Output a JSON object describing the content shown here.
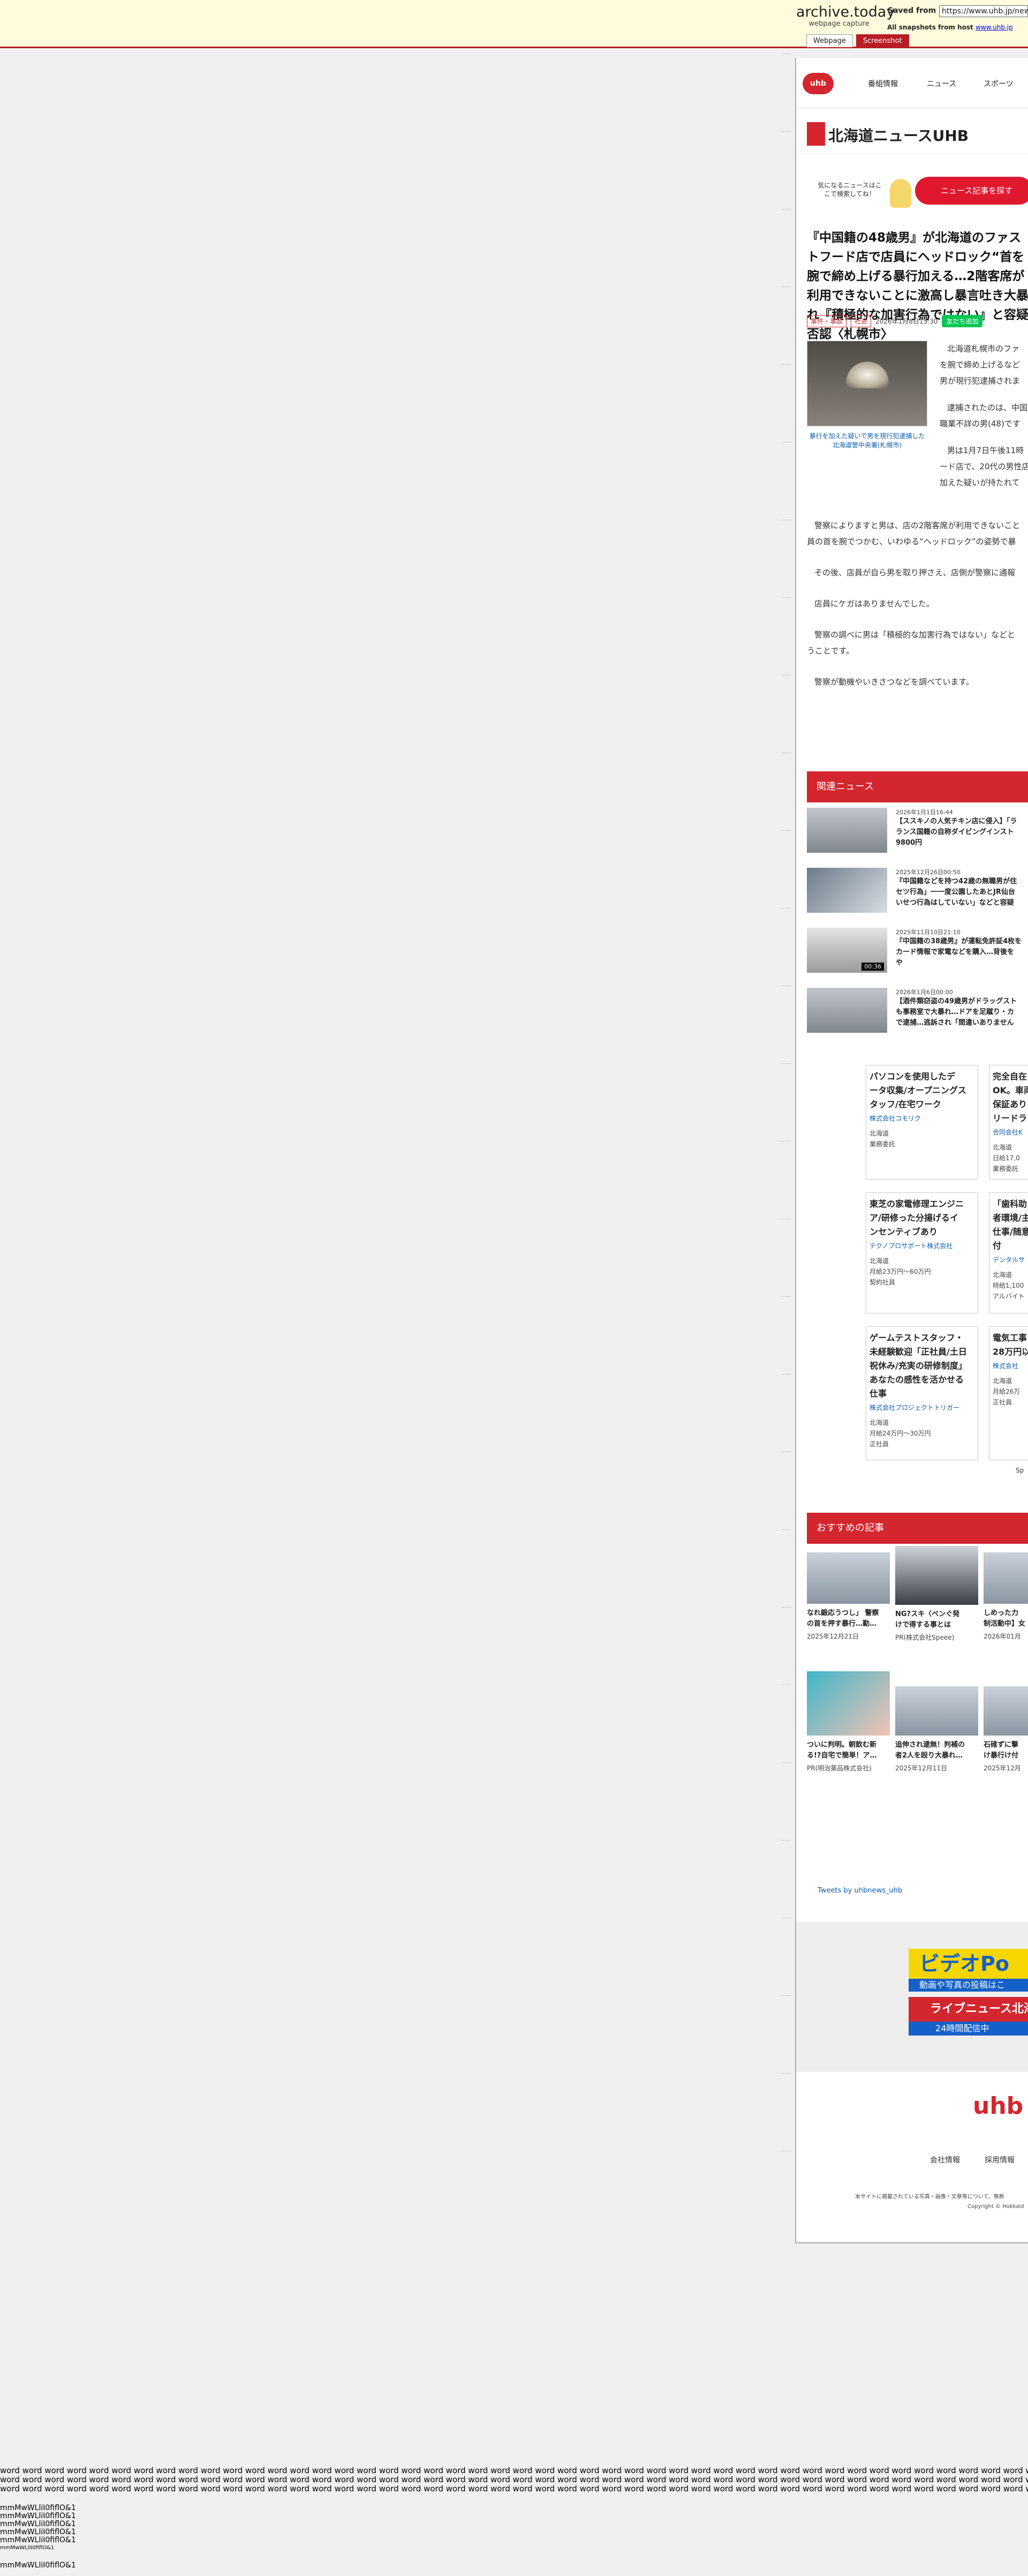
{
  "archive": {
    "title": "archive.today",
    "subtitle": "webpage capture",
    "saved_from_label": "Saved from",
    "saved_url": "https://www.uhb.jp/news/",
    "all_snapshots_label": "All snapshots from host",
    "host": "www.uhb.jp",
    "tab_webpage": "Webpage",
    "tab_screenshot": "Screenshot"
  },
  "nav": {
    "logo": "uhb",
    "items": [
      "番組情報",
      "ニュース",
      "スポーツ"
    ]
  },
  "brand": {
    "name": "北海道ニュースUHB"
  },
  "cta": {
    "note": "気になるニュースはここで検索してね！",
    "button": "ニュース記事を探す"
  },
  "article": {
    "headline": "『中国籍の48歳男』が北海道のファストフード店で店員にヘッドロック“首を腕で締め上げる暴行加える…2階客席が利用できないことに激高し暴言吐き大暴れ『積極的な加害行為ではない』と容疑否認〈札幌市〉",
    "tags": [
      "事件・事故",
      "社会"
    ],
    "date": "2026年1月8日15:30",
    "line_button": "友だち追加",
    "caption": "暴行を加えた疑いで男を現行犯逮捕した北海道警中央署(札幌市)",
    "paragraphs_side": [
      "北海道札幌市のファ",
      "を腕で締め上げるなど",
      "男が現行犯逮捕されま",
      "逮捕されたのは、中国",
      "職業不詳の男(48)です",
      "男は1月7日午後11時",
      "ード店で、20代の男性店",
      "加えた疑いが持たれて"
    ],
    "paragraphs": [
      "警察によりますと男は、店の2階客席が利用できないこと",
      "員の首を腕でつかむ、いわゆる“ヘッドロック”の姿勢で暴",
      "その後、店員が自ら男を取り押さえ、店側が警察に通報",
      "店員にケガはありませんでした。",
      "警察の調べに男は「積極的な加害行為ではない」などと",
      "うことです。",
      "警察が動機やいきさつなどを調べています。"
    ]
  },
  "related": {
    "heading": "関連ニュース",
    "items": [
      {
        "date": "2026年1月1日16:44",
        "title": "【ススキノの人気チキン店に侵入】「ラ",
        "title2": "ランス国籍の自称ダイビングインスト",
        "title3": "9800円",
        "duration": ""
      },
      {
        "date": "2025年12月26日00:50",
        "title": "『中国籍などを持つ42歳の無職男が住",
        "title2": "セツ行為」一一度公園したあとJR仙台",
        "title3": "いせつ行為はしていない」などと容疑",
        "duration": ""
      },
      {
        "date": "2025年11月10日21:10",
        "title": "『中国籍の38歳男』が運転免許証4枚を",
        "title2": "カード情報で家電などを購入…背後を",
        "title3": "や",
        "duration": "00:36"
      },
      {
        "date": "2026年1月6日00:00",
        "title": "【酒件類窃盗の49歳男がドラッグスト",
        "title2": "も事務室で大暴れ…ドアを足蹴り・カ",
        "title3": "で逮捕…逃訴され「間違いありません",
        "duration": ""
      }
    ]
  },
  "jobs": [
    {
      "title": [
        "パソコンを使用したデ",
        "ータ収集/オープニングス",
        "タッフ/在宅ワーク"
      ],
      "company": "株式会社コモリク",
      "details": [
        "北海道",
        "業務委託"
      ]
    },
    {
      "title": [
        "完全自在",
        "OK。車両",
        "保証あり",
        "リードラ"
      ],
      "company": "合同会社K",
      "details": [
        "北海道",
        "日給17,0",
        "業務委託"
      ]
    },
    {
      "title": [
        "東芝の家電修理エンジニ",
        "ア/研修った分揚げるイ",
        "ンセンティブあり"
      ],
      "company": "テクノプロサポート株式会社",
      "details": [
        "北海道",
        "月給23万円〜60万円",
        "契約社員"
      ]
    },
    {
      "title": [
        "「歯科助",
        "者環境/主",
        "仕事/随意",
        "付"
      ],
      "company": "デンタルサ",
      "details": [
        "北海道",
        "時給1,100",
        "アルバイト"
      ]
    },
    {
      "title": [
        "ゲームテストスタッフ・",
        "未経験歓迎「正社員/土日",
        "祝休み/充実の研修制度」",
        "あなたの感性を活かせる",
        "仕事"
      ],
      "company": "株式会社プロジェクトトリガー",
      "details": [
        "北海道",
        "月給24万円〜30万円",
        "正社員"
      ]
    },
    {
      "title": [
        "電気工事",
        "28万円以"
      ],
      "company": "株式会社",
      "details": [
        "北海道",
        "月給26万",
        "正社員"
      ]
    }
  ],
  "sponsor": "Sp",
  "recommended": {
    "heading": "おすすめの記事",
    "items": [
      {
        "title": "なれ鍛応うつし」 警察",
        "title2": "の首を押す暴行…勤…",
        "meta": "2025年12月21日"
      },
      {
        "title": "NG?スキ〈べンぐ発",
        "title2": "けで得する事とは",
        "meta": "PR(株式会社Speee)"
      },
      {
        "title": "しめった力",
        "title2": "制活動中】女",
        "meta": "2026年01月"
      },
      {
        "title": "ついに判明。朝飲む新",
        "title2": "る!?自宅で簡単！ア…",
        "meta": "PR(明治薬品株式会社)"
      },
      {
        "title": "追伸され逮無！判補の",
        "title2": "者2人を殴り大暴れ…",
        "meta": "2025年12月11日"
      },
      {
        "title": "石碓ずに撃",
        "title2": "け暴行け付",
        "meta": "2025年12月"
      }
    ]
  },
  "tweets": "Tweets by uhbnews_uhb",
  "ads": {
    "ad1": "ビデオPo",
    "ad1_sub": "動画や写真の投稿はこ",
    "ad2": "ライブニュース北海",
    "ad2_sub": "24時間配信中"
  },
  "footer": {
    "logo": "uhb",
    "links": [
      "会社情報",
      "採用情報"
    ],
    "disclaimer": "本サイトに掲載されている写真・画像・文章等について、無断",
    "copyright": "Copyright © Hokkaid"
  },
  "bottom": {
    "word_lines": [
      "word word word word word word word word word word word word word word word word word word word word word word word word word word word word word word word word word word word word word word word word word word word word word word word word word word word word word word word word word word word word word word word word word word word word word word word word word word word word word word word word word word word word word word word word word",
      "word word word word word word word word word word word word word word word word word word word word word word word word word word word word word word word word word word word word word word word word word word word word word word word word word word word word word word word word word word word word word word word word word word word word word word word word word word word word word word word word word word word word word word word word word word word word",
      "word word word word word word word word word word word word word word word word word word word word word word word word word word word word word word word word word word word word word word word word word word word word word word word word"
    ],
    "mm_lines": [
      "mmMwWLliI0fiflO&1",
      "mmMwWLliI0fiflO&1",
      "mmMwWLliI0fiflO&1",
      "mmMwWLliI0fiflO&1",
      "mmMwWLliI0fiflO&1"
    ],
    "mm_small": "mmMwWLliI0fiflO&1",
    "mm_last": "mmMwWLliI0fiflO&1"
  }
}
